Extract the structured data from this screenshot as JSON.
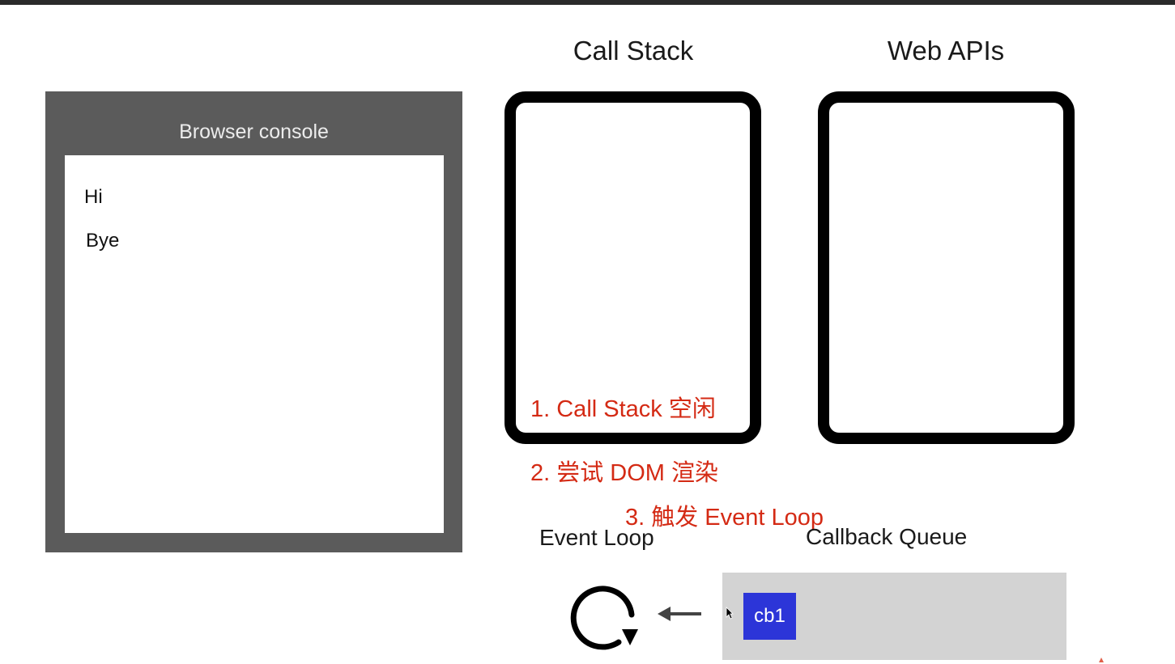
{
  "console": {
    "title": "Browser console",
    "lines": [
      "Hi",
      "Bye"
    ]
  },
  "headings": {
    "call_stack": "Call Stack",
    "web_apis": "Web APIs"
  },
  "notes": {
    "step1": "1. Call Stack 空闲",
    "step2": "2. 尝试 DOM 渲染",
    "step3": "3. 触发 Event Loop"
  },
  "labels": {
    "event_loop": "Event Loop",
    "callback_queue": "Callback Queue"
  },
  "queue": {
    "items": [
      "cb1"
    ]
  },
  "icons": {
    "event_loop": "refresh-loop-icon",
    "arrow": "arrow-left-icon",
    "cursor": "mouse-cursor-icon"
  },
  "colors": {
    "note_red": "#d42a14",
    "cb_blue": "#2c35d8",
    "console_frame": "#5b5b5b",
    "queue_gray": "#d3d3d3"
  }
}
